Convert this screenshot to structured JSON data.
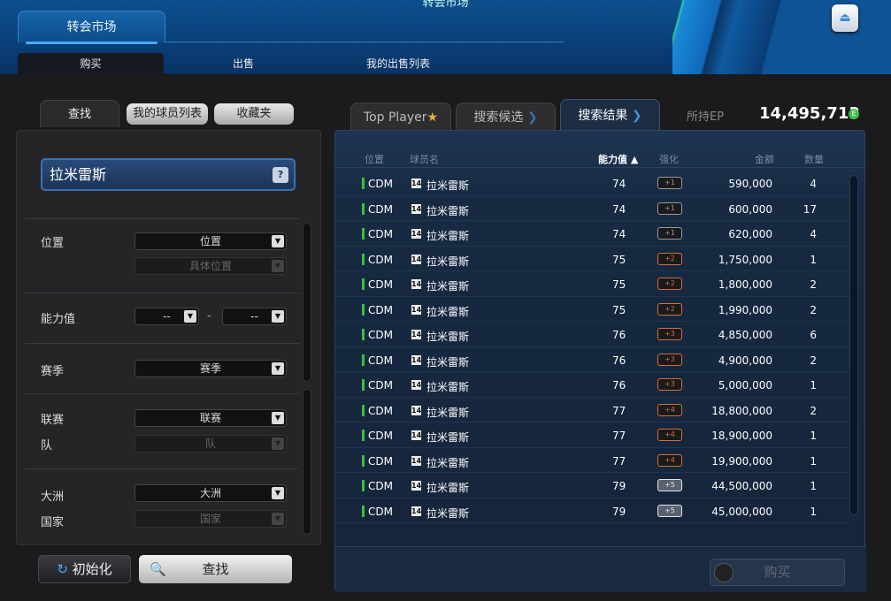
{
  "header": {
    "title": "转会市场",
    "main_tab": "转会市场",
    "subtabs": [
      "购买",
      "出售",
      "我的出售列表"
    ]
  },
  "left": {
    "tabs": [
      "查找",
      "我的球员列表",
      "收藏夹"
    ],
    "search_value": "拉米雷斯",
    "help": "?",
    "filters": [
      {
        "label": "位置",
        "select": "位置",
        "sub": "具体位置"
      },
      {
        "label": "能力值",
        "min": "--",
        "max": "--",
        "dash": "-"
      },
      {
        "label": "赛季",
        "select": "赛季"
      },
      {
        "label": "联赛",
        "select": "联赛"
      },
      {
        "label": "队",
        "select": "队"
      },
      {
        "label": "大洲",
        "select": "大洲"
      },
      {
        "label": "国家",
        "select": "国家"
      }
    ],
    "reset_label": "初始化",
    "find_label": "查找"
  },
  "right": {
    "tabs": [
      "Top Player",
      "搜索候选",
      "搜索结果"
    ],
    "ep_label": "所持EP",
    "ep_value": "14,495,713",
    "ep_icon": "E",
    "columns": [
      "位置",
      "球员名",
      "能力值 ▲",
      "强化",
      "金额",
      "数量"
    ],
    "rows": [
      [
        "CDM",
        "拉米雷斯",
        "74",
        "+1",
        "590,000",
        "4"
      ],
      [
        "CDM",
        "拉米雷斯",
        "74",
        "+1",
        "600,000",
        "17"
      ],
      [
        "CDM",
        "拉米雷斯",
        "74",
        "+1",
        "620,000",
        "4"
      ],
      [
        "CDM",
        "拉米雷斯",
        "75",
        "+2",
        "1,750,000",
        "1"
      ],
      [
        "CDM",
        "拉米雷斯",
        "75",
        "+2",
        "1,800,000",
        "2"
      ],
      [
        "CDM",
        "拉米雷斯",
        "75",
        "+2",
        "1,990,000",
        "2"
      ],
      [
        "CDM",
        "拉米雷斯",
        "76",
        "+3",
        "4,850,000",
        "6"
      ],
      [
        "CDM",
        "拉米雷斯",
        "76",
        "+3",
        "4,900,000",
        "2"
      ],
      [
        "CDM",
        "拉米雷斯",
        "76",
        "+3",
        "5,000,000",
        "1"
      ],
      [
        "CDM",
        "拉米雷斯",
        "77",
        "+4",
        "18,800,000",
        "2"
      ],
      [
        "CDM",
        "拉米雷斯",
        "77",
        "+4",
        "18,900,000",
        "1"
      ],
      [
        "CDM",
        "拉米雷斯",
        "77",
        "+4",
        "19,900,000",
        "1"
      ],
      [
        "CDM",
        "拉米雷斯",
        "79",
        "+5",
        "44,500,000",
        "1"
      ],
      [
        "CDM",
        "拉米雷斯",
        "79",
        "+5",
        "45,000,000",
        "1"
      ]
    ],
    "season_badge": "14",
    "buy_label": "购买",
    "enh_colors": {
      "+1": "#9a9a9a",
      "+2": "#d0703a",
      "+3": "#d0703a",
      "+4": "#d0703a",
      "+5": "#e0e6ee"
    }
  }
}
